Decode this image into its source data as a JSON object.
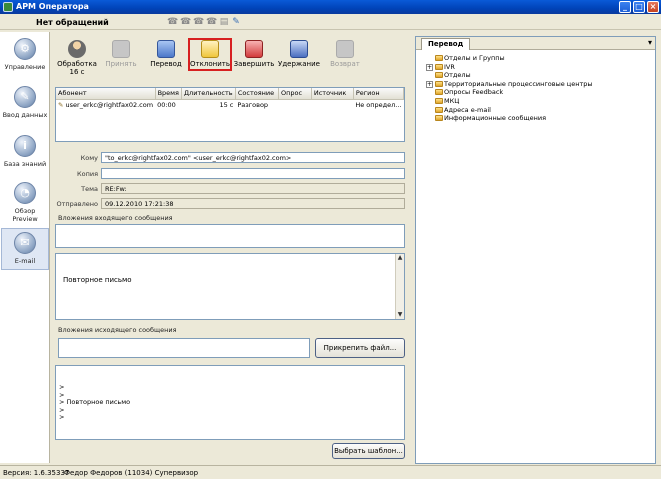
{
  "window": {
    "title": "АРМ Оператора",
    "min": "_",
    "max": "□",
    "close": "×"
  },
  "status": {
    "text": "Нет обращений"
  },
  "sidebar": {
    "items": [
      {
        "label": "Управление",
        "icon": "gear-icon",
        "glyph": "⚙"
      },
      {
        "label": "Ввод данных",
        "icon": "pencil-icon",
        "glyph": "✎"
      },
      {
        "label": "База знаний",
        "icon": "info-icon",
        "glyph": "i"
      },
      {
        "label": "Обзор Preview",
        "icon": "preview-icon",
        "glyph": "◔"
      },
      {
        "label": "E-mail",
        "icon": "email-icon",
        "glyph": "✉"
      }
    ]
  },
  "toolbar": {
    "processing": {
      "line1": "Обработка",
      "line2": "16 с"
    },
    "accept": "Принять",
    "transfer": "Перевод",
    "decline": "Отклонить",
    "finish": "Завершить",
    "hold": "Удержание",
    "return": "Возврат"
  },
  "grid": {
    "headers": [
      "Абонент",
      "Время",
      "Длительность",
      "Состояние",
      "Опрос",
      "Источник",
      "Регион"
    ],
    "rows": [
      {
        "subscriber": "user_erkc@rightfax02.com",
        "time": "00:00",
        "duration": "15 с",
        "state": "Разговор",
        "poll": "",
        "source": "",
        "region": "Не определ..."
      }
    ]
  },
  "form": {
    "to_label": "Кому",
    "to_value": "\"to_erkc@rightfax02.com\" <user_erkc@rightfax02.com>",
    "cc_label": "Копия",
    "cc_value": "",
    "subject_label": "Тема",
    "subject_value": "RE:Fw:",
    "sent_label": "Отправлено",
    "sent_value": "09.12.2010 17:21:38"
  },
  "incoming": {
    "label": "Вложения входящего сообщения"
  },
  "message": {
    "body": "Повторное письмо"
  },
  "outgoing": {
    "label": "Вложения исходящего сообщения",
    "attach_button": "Прикрепить файл..."
  },
  "reply": {
    "lines": [
      ">",
      ">",
      "> Повторное письмо",
      ">",
      ">"
    ]
  },
  "template_button": "Выбрать шаблон...",
  "right_panel": {
    "tab": "Перевод",
    "tree": [
      {
        "label": "Отделы и Группы",
        "expandable": false
      },
      {
        "label": "IVR",
        "expandable": true
      },
      {
        "label": "Отделы",
        "expandable": false
      },
      {
        "label": "Территориальные процессинговые центры",
        "expandable": true
      },
      {
        "label": "Опросы Feedback",
        "expandable": false
      },
      {
        "label": "МКЦ",
        "expandable": false
      },
      {
        "label": "Адреса e-mail",
        "expandable": false
      },
      {
        "label": "Информационные сообщения",
        "expandable": false
      }
    ]
  },
  "statusbar": {
    "version": "Версия: 1.6.35337",
    "user": "Федор Федоров (11034) Супервизор"
  }
}
